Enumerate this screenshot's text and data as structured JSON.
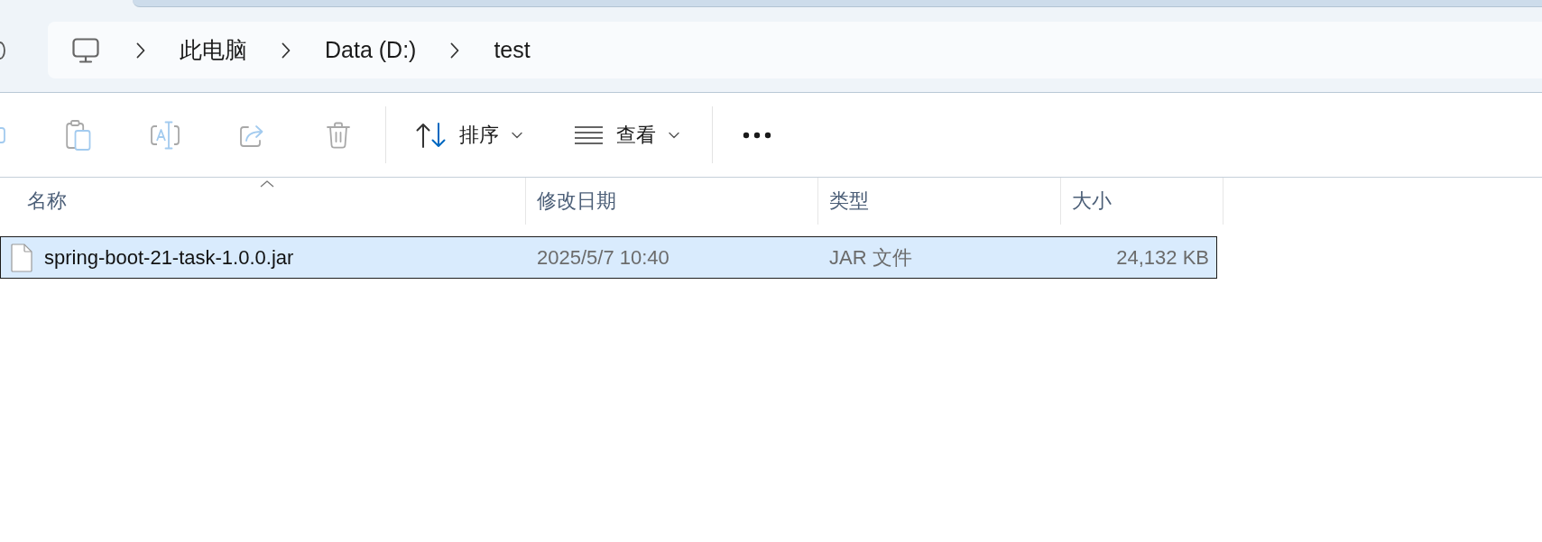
{
  "address_bar": {
    "crumbs": [
      {
        "label": "此电脑"
      },
      {
        "label": "Data (D:)"
      },
      {
        "label": "test"
      }
    ]
  },
  "toolbar": {
    "items": [
      {
        "kind": "icon",
        "disabled": true
      },
      {
        "kind": "icon",
        "disabled": true
      },
      {
        "kind": "icon",
        "disabled": true
      },
      {
        "kind": "icon",
        "disabled": true
      },
      {
        "kind": "separator"
      },
      {
        "kind": "menu",
        "label": "排序",
        "disabled": false
      },
      {
        "kind": "menu",
        "label": "查看",
        "disabled": false
      },
      {
        "kind": "separator"
      },
      {
        "kind": "more",
        "disabled": false
      }
    ]
  },
  "columns": [
    {
      "label": "名称",
      "sorted": true
    },
    {
      "label": "修改日期",
      "sorted": false
    },
    {
      "label": "类型",
      "sorted": false
    },
    {
      "label": "大小",
      "sorted": false
    }
  ],
  "rows": [
    {
      "name": "spring-boot-21-task-1.0.0.jar",
      "modified": "2025/5/7 10:40",
      "type": "JAR 文件",
      "size": "24,132 KB",
      "selected": true
    }
  ]
}
